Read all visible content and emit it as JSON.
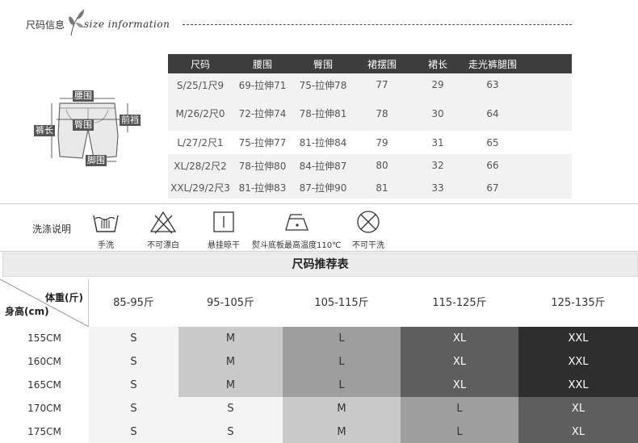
{
  "header": {
    "title_cn": "尺码信息",
    "title_en": "size information"
  },
  "diagram": {
    "labels": {
      "waist": "腰围",
      "hip": "臀围",
      "front_rise": "前裆",
      "length": "裤长",
      "hem": "脚围"
    }
  },
  "size_table": {
    "headers": [
      "尺码",
      "腰围",
      "臀围",
      "裙摆围",
      "裙长",
      "走光裤腿围"
    ],
    "rows": [
      [
        "S/25/1尺9",
        "69-拉伸71",
        "75-拉伸78",
        "77",
        "29",
        "63"
      ],
      [
        "M/26/2尺0",
        "72-拉伸74",
        "78-拉伸81",
        "78",
        "30",
        "64"
      ],
      [
        "L/27/2尺1",
        "75-拉伸77",
        "81-拉伸84",
        "79",
        "31",
        "65"
      ],
      [
        "XL/28/2尺2",
        "78-拉伸80",
        "84-拉伸87",
        "80",
        "32",
        "66"
      ],
      [
        "XXL/29/2尺3",
        "81-拉伸83",
        "87-拉伸90",
        "81",
        "33",
        "67"
      ]
    ]
  },
  "care": {
    "title": "洗涤说明",
    "items": [
      {
        "icon": "hand-wash-icon",
        "label": "手洗"
      },
      {
        "icon": "no-bleach-icon",
        "label": "不可漂白"
      },
      {
        "icon": "hang-dry-icon",
        "label": "悬挂晾干"
      },
      {
        "icon": "iron-icon",
        "label": "熨斗底板最高温度110℃"
      },
      {
        "icon": "no-tumble-dry-icon",
        "label": "不可干洗"
      }
    ]
  },
  "recommend": {
    "title": "尺码推荐表",
    "corner_weight": "体重(斤)",
    "corner_height": "身高(cm)",
    "weights": [
      "85-95斤",
      "95-105斤",
      "105-115斤",
      "115-125斤",
      "125-135斤"
    ],
    "heights": [
      "155CM",
      "160CM",
      "165CM",
      "170CM",
      "175CM"
    ],
    "cells": [
      [
        "S",
        "M",
        "L",
        "XL",
        "XXL"
      ],
      [
        "S",
        "M",
        "L",
        "XL",
        "XXL"
      ],
      [
        "S",
        "M",
        "L",
        "XL",
        "XXL"
      ],
      [
        "S",
        "S",
        "M",
        "L",
        "XL"
      ],
      [
        "S",
        "S",
        "M",
        "L",
        "XL"
      ]
    ],
    "size_colors": {
      "S": {
        "bg": "#f4f4f4",
        "fg": "#333333"
      },
      "M": {
        "bg": "#c9c9c9",
        "fg": "#333333"
      },
      "L": {
        "bg": "#9e9e9e",
        "fg": "#333333"
      },
      "XL": {
        "bg": "#5e5e5e",
        "fg": "#ffffff"
      },
      "XXL": {
        "bg": "#2e2e2e",
        "fg": "#ffffff"
      }
    }
  }
}
